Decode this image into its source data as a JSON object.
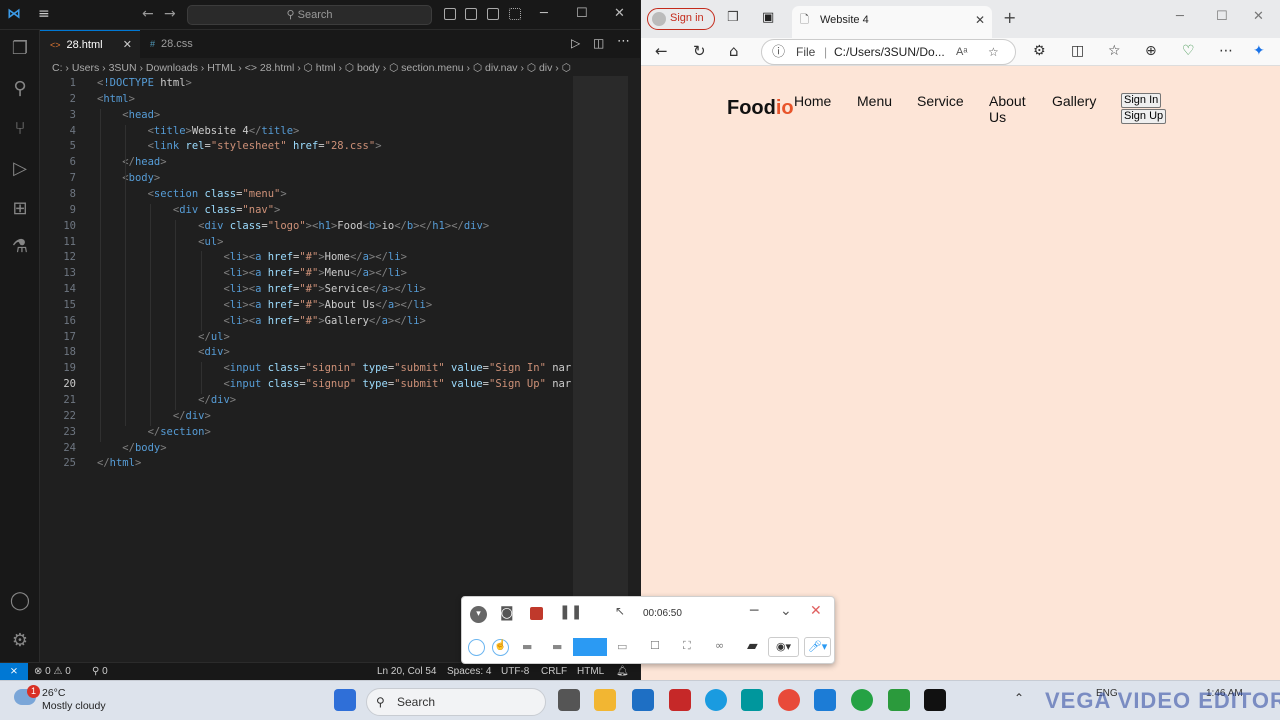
{
  "vscode": {
    "search_placeholder": "Search",
    "tabs": [
      {
        "icon": "<>",
        "label": "28.html",
        "close": "✕"
      },
      {
        "icon": "#",
        "label": "28.css"
      }
    ],
    "breadcrumb": "C: › Users › 3SUN › Downloads › HTML › <> 28.html › ⬡ html › ⬡ body › ⬡ section.menu › ⬡ div.nav › ⬡ div › ⬡",
    "lines": [
      "<!DOCTYPE html>",
      "<html>",
      "    <head>",
      "        <title>Website 4</title>",
      "        <link rel=\"stylesheet\" href=\"28.css\">",
      "    </head>",
      "    <body>",
      "        <section class=\"menu\">",
      "            <div class=\"nav\">",
      "                <div class=\"logo\"><h1>Food<b>io</b></h1></div>",
      "                <ul>",
      "                    <li><a href=\"#\">Home</a></li>",
      "                    <li><a href=\"#\">Menu</a></li>",
      "                    <li><a href=\"#\">Service</a></li>",
      "                    <li><a href=\"#\">About Us</a></li>",
      "                    <li><a href=\"#\">Gallery</a></li>",
      "                </ul>",
      "                <div>",
      "                    <input class=\"signin\" type=\"submit\" value=\"Sign In\" nar",
      "                    <input class=\"signup\" type=\"submit\" value=\"Sign Up\" nar",
      "                </div>",
      "            </div>",
      "        </section>",
      "    </body>",
      "</html>"
    ],
    "current_line": 20,
    "status": {
      "errors": "⊗ 0 ⚠ 0",
      "ports": "⚲ 0",
      "position": "Ln 20, Col 54",
      "spaces": "Spaces: 4",
      "encoding": "UTF-8",
      "eol": "CRLF",
      "language": "HTML"
    }
  },
  "edge": {
    "sign_in": "Sign in",
    "tab_title": "Website 4",
    "url_file": "File",
    "url": "C:/Users/3SUN/Do..."
  },
  "page": {
    "logo_main": "Food",
    "logo_accent": "io",
    "nav": [
      "Home",
      "Menu",
      "Service",
      "About Us",
      "Gallery"
    ],
    "sign_in_button": "Sign In",
    "sign_up_button": "Sign Up"
  },
  "recorder": {
    "time": "00:06:50"
  },
  "taskbar": {
    "weather_badge": "1",
    "temperature": "26°C",
    "condition": "Mostly cloudy",
    "search": "Search",
    "lang": "ENG",
    "time": "1:46 AM"
  },
  "watermark": "VEGA VIDEO EDITOR",
  "colors": {
    "accent": "#e8542a",
    "vscode_blue": "#0078d4",
    "page_bg": "#fde5d7"
  }
}
